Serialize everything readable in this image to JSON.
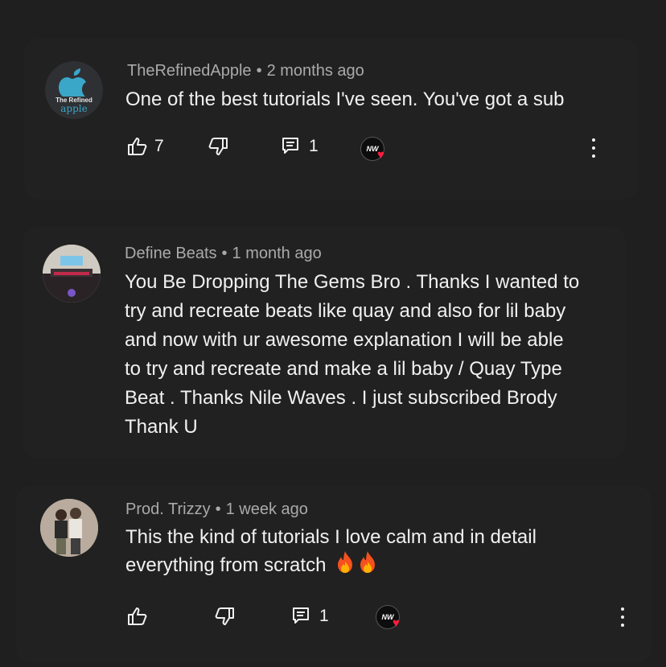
{
  "comments": [
    {
      "author": "TheRefinedApple",
      "separator": "•",
      "time": "2 months ago",
      "text": "One of the best tutorials I've seen. You've got a sub",
      "likes": "7",
      "replies": "1",
      "avatar": {
        "line1": "The Refined",
        "line2": "apple",
        "accent": "#3aa6c8"
      }
    },
    {
      "author": "Define Beats",
      "separator": "•",
      "time": "1 month ago",
      "lines": [
        "You Be Dropping The Gems Bro . Thanks I wanted to",
        "try and recreate beats like quay and also for lil baby",
        "and now with ur awesome explanation I will be able",
        "to try and recreate and make a lil baby / Quay Type",
        "Beat . Thanks Nile Waves . I just subscribed Brody",
        "Thank U"
      ]
    },
    {
      "author": "Prod. Trizzy",
      "separator": "•",
      "time": "1 week ago",
      "lines": [
        "This the kind of tutorials I love calm and in detail",
        "everything from scratch"
      ],
      "replies": "1"
    }
  ],
  "creator_badge": {
    "initials": "NW",
    "heart_color": "#ff1e3c"
  },
  "colors": {
    "background": "#1f1f1f",
    "card": "#212121",
    "text": "#f1f1f1",
    "meta": "#aaaaaa"
  }
}
